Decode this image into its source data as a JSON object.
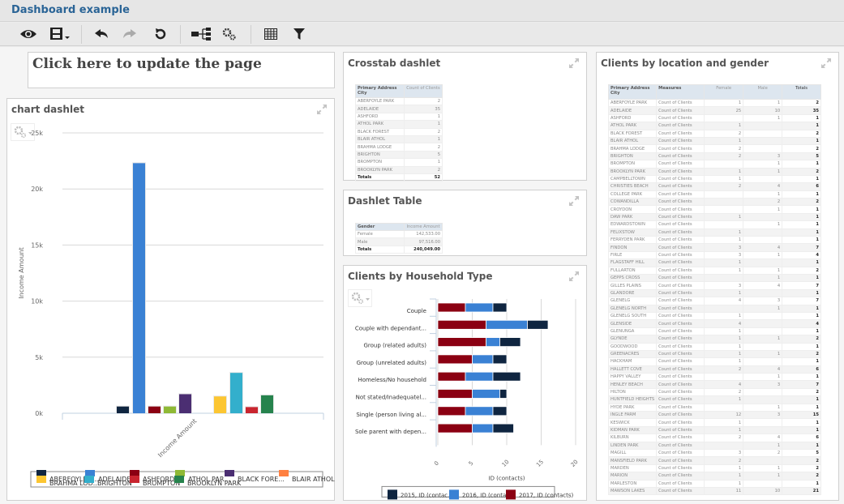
{
  "app": {
    "title": "Dashboard example"
  },
  "toolbar": {
    "icons": [
      "eye-icon",
      "save-icon",
      "undo-icon",
      "redo-icon",
      "reset-icon",
      "hierarchy-icon",
      "settings-gears-icon",
      "grid-icon",
      "filter-icon"
    ]
  },
  "update_link": "Click here to update the page",
  "chart_dashlet": {
    "title": "chart dashlet"
  },
  "crosstab_dashlet": {
    "title": "Crosstab dashlet",
    "headers": [
      "Primary Address City",
      "Count of Clients"
    ],
    "rows": [
      [
        "ABERFOYLE PARK",
        "2"
      ],
      [
        "ADELAIDE",
        "35"
      ],
      [
        "ASHFORD",
        "1"
      ],
      [
        "ATHOL PARK",
        "1"
      ],
      [
        "BLACK FOREST",
        "2"
      ],
      [
        "BLAIR ATHOL",
        "1"
      ],
      [
        "BRAHMA LODGE",
        "2"
      ],
      [
        "BRIGHTON",
        "5"
      ],
      [
        "BROMPTON",
        "1"
      ],
      [
        "BROOKLYN PARK",
        "2"
      ]
    ],
    "totals": [
      "Totals",
      "52"
    ]
  },
  "dashlet_table": {
    "title": "Dashlet Table",
    "headers": [
      "Gender",
      "Income Amount"
    ],
    "rows": [
      [
        "Female",
        "142,533.00"
      ],
      [
        "Male",
        "97,516.00"
      ]
    ],
    "totals": [
      "Totals",
      "240,049.00"
    ]
  },
  "household_dashlet": {
    "title": "Clients by Household Type"
  },
  "location_dashlet": {
    "title": "Clients by location and gender",
    "headers": [
      "Primary Address City",
      "Measures",
      "Female",
      "Male",
      "Totals"
    ],
    "measure": "Count of Clients",
    "rows": [
      [
        "ABERFOYLE PARK",
        "1",
        "1",
        "2"
      ],
      [
        "ADELAIDE",
        "25",
        "10",
        "35"
      ],
      [
        "ASHFORD",
        "",
        "1",
        "1"
      ],
      [
        "ATHOL PARK",
        "1",
        "",
        "1"
      ],
      [
        "BLACK FOREST",
        "2",
        "",
        "2"
      ],
      [
        "BLAIR ATHOL",
        "1",
        "",
        "1"
      ],
      [
        "BRAHMA LODGE",
        "2",
        "",
        "2"
      ],
      [
        "BRIGHTON",
        "2",
        "3",
        "5"
      ],
      [
        "BROMPTON",
        "",
        "1",
        "1"
      ],
      [
        "BROOKLYN PARK",
        "1",
        "1",
        "2"
      ],
      [
        "CAMPBELLTOWN",
        "1",
        "",
        "1"
      ],
      [
        "CHRISTIES BEACH",
        "2",
        "4",
        "6"
      ],
      [
        "COLLEGE PARK",
        "",
        "1",
        "1"
      ],
      [
        "COWANDILLA",
        "",
        "2",
        "2"
      ],
      [
        "CROYDON",
        "",
        "1",
        "1"
      ],
      [
        "DAW PARK",
        "1",
        "",
        "1"
      ],
      [
        "EDWARDSTOWN",
        "",
        "1",
        "1"
      ],
      [
        "FELIXSTOW",
        "1",
        "",
        "1"
      ],
      [
        "FERRYDEN PARK",
        "1",
        "",
        "1"
      ],
      [
        "FINDON",
        "3",
        "4",
        "7"
      ],
      [
        "FIRLE",
        "3",
        "1",
        "4"
      ],
      [
        "FLAGSTAFF HILL",
        "1",
        "",
        "1"
      ],
      [
        "FULLARTON",
        "1",
        "1",
        "2"
      ],
      [
        "GEPPS CROSS",
        "",
        "1",
        "1"
      ],
      [
        "GILLES PLAINS",
        "3",
        "4",
        "7"
      ],
      [
        "GLANDORE",
        "1",
        "",
        "1"
      ],
      [
        "GLENELG",
        "4",
        "3",
        "7"
      ],
      [
        "GLENELG NORTH",
        "",
        "1",
        "1"
      ],
      [
        "GLENELG SOUTH",
        "1",
        "",
        "1"
      ],
      [
        "GLENSIDE",
        "4",
        "",
        "4"
      ],
      [
        "GLENUNGA",
        "1",
        "",
        "1"
      ],
      [
        "GLYNDE",
        "1",
        "1",
        "2"
      ],
      [
        "GOODWOOD",
        "1",
        "",
        "1"
      ],
      [
        "GREENACRES",
        "1",
        "1",
        "2"
      ],
      [
        "HACKHAM",
        "1",
        "",
        "1"
      ],
      [
        "HALLETT COVE",
        "2",
        "4",
        "6"
      ],
      [
        "HAPPY VALLEY",
        "",
        "1",
        "1"
      ],
      [
        "HENLEY BEACH",
        "4",
        "3",
        "7"
      ],
      [
        "HILTON",
        "2",
        "",
        "2"
      ],
      [
        "HUNTFIELD HEIGHTS",
        "1",
        "",
        "1"
      ],
      [
        "HYDE PARK",
        "",
        "1",
        "1"
      ],
      [
        "INGLE FARM",
        "12",
        "3",
        "15"
      ],
      [
        "KESWICK",
        "1",
        "",
        "1"
      ],
      [
        "KIDMAN PARK",
        "1",
        "",
        "1"
      ],
      [
        "KILBURN",
        "2",
        "4",
        "6"
      ],
      [
        "LINDEN PARK",
        "",
        "1",
        "1"
      ],
      [
        "MAGILL",
        "3",
        "2",
        "5"
      ],
      [
        "MANSFIELD PARK",
        "2",
        "",
        "2"
      ],
      [
        "MARDEN",
        "1",
        "1",
        "2"
      ],
      [
        "MARION",
        "1",
        "1",
        "2"
      ],
      [
        "MARLESTON",
        "1",
        "",
        "1"
      ],
      [
        "MAWSON LAKES",
        "11",
        "10",
        "21"
      ]
    ]
  },
  "chart_data": [
    {
      "type": "bar",
      "title": "chart dashlet",
      "xlabel": "Income Amount",
      "ylabel": "Income Amount",
      "categories": [
        "Income Amount"
      ],
      "ylim": [
        0,
        25000
      ],
      "yticks": [
        "0k",
        "5k",
        "10k",
        "15k",
        "20k",
        "25k"
      ],
      "grid": true,
      "legend": "bottom",
      "series": [
        {
          "name": "ABERFOYLE PARK",
          "value": 600,
          "color": "#0f2540"
        },
        {
          "name": "ADELAIDE",
          "value": 22300,
          "color": "#3a81d4"
        },
        {
          "name": "ASHFORD",
          "value": 600,
          "color": "#8b0012"
        },
        {
          "name": "ATHOL PARK",
          "value": 600,
          "color": "#8fb935"
        },
        {
          "name": "BLACK FOREST",
          "value": 1700,
          "color": "#4b2e72"
        },
        {
          "name": "BLAIR ATHOL",
          "value": 0,
          "color": "#ff8040"
        },
        {
          "name": "BRAHMA LODGE",
          "value": 1500,
          "color": "#fcc632"
        },
        {
          "name": "BRIGHTON",
          "value": 3600,
          "color": "#33afcc"
        },
        {
          "name": "BROMPTON",
          "value": 550,
          "color": "#c9252f"
        },
        {
          "name": "BROOKLYN PARK",
          "value": 1600,
          "color": "#26834d"
        }
      ],
      "legend_labels_visible": [
        "ABERFOYLE P...",
        "ADELAIDE",
        "ASHFORD",
        "ATHOL PAR...",
        "BLACK FORE...",
        "BLAIR ATHOL",
        "BRAHMA LOD...",
        "BRIGHTON",
        "BROMPTON",
        "BROOKLYN PARK"
      ]
    },
    {
      "type": "bar",
      "orientation": "horizontal",
      "stacked": true,
      "title": "Clients by Household Type",
      "xlabel": "ID (contacts)",
      "ylabel": "",
      "xlim": [
        0,
        20
      ],
      "xticks": [
        "0",
        "5",
        "10",
        "15",
        "20"
      ],
      "grid": true,
      "legend": "bottom",
      "categories": [
        "Couple",
        "Couple with dependant...",
        "Group (related adults)",
        "Group (unrelated adults)",
        "Homeless/No household",
        "Not stated/Inadequatel...",
        "Single (person living al...",
        "Sole parent with depen..."
      ],
      "series": [
        {
          "name": "2017, ID (contacts)",
          "color": "#8b0012",
          "values": [
            4,
            7,
            7,
            5,
            4,
            5,
            4,
            5
          ]
        },
        {
          "name": "2016, ID (contacts)",
          "color": "#3a81d4",
          "values": [
            4,
            6,
            2,
            3,
            4,
            4,
            4,
            3
          ]
        },
        {
          "name": "2015, ID (contacts)",
          "color": "#0f2540",
          "values": [
            2,
            3,
            3,
            2,
            4,
            1,
            2,
            3
          ]
        }
      ],
      "legend_labels_visible": [
        "2015, ID (contac...",
        "2016, ID (contac...",
        "2017, ID (contacts)"
      ]
    }
  ]
}
